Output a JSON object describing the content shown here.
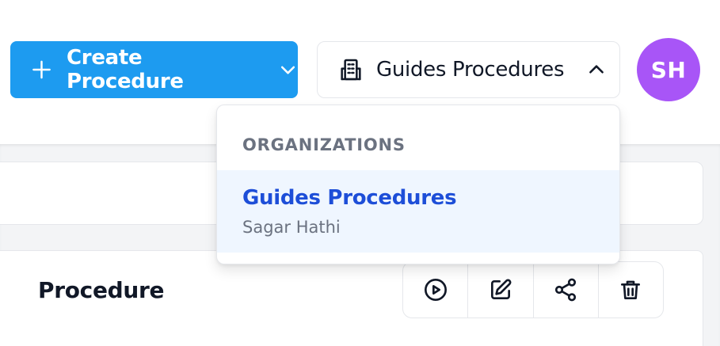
{
  "header": {
    "create_label": "Create Procedure",
    "org_label": "Guides Procedures",
    "avatar_initials": "SH"
  },
  "dropdown": {
    "section_label": "ORGANIZATIONS",
    "items": [
      {
        "title": "Guides Procedures",
        "subtitle": "Sagar Hathi"
      }
    ]
  },
  "card": {
    "title": "Procedure",
    "actions": [
      {
        "icon": "play-circle-icon"
      },
      {
        "icon": "edit-icon"
      },
      {
        "icon": "share-icon"
      },
      {
        "icon": "trash-icon"
      }
    ]
  },
  "colors": {
    "primary": "#1d9bf0",
    "avatar": "#a855f7",
    "link": "#1d4ed8",
    "selected_bg": "#eff6ff"
  }
}
